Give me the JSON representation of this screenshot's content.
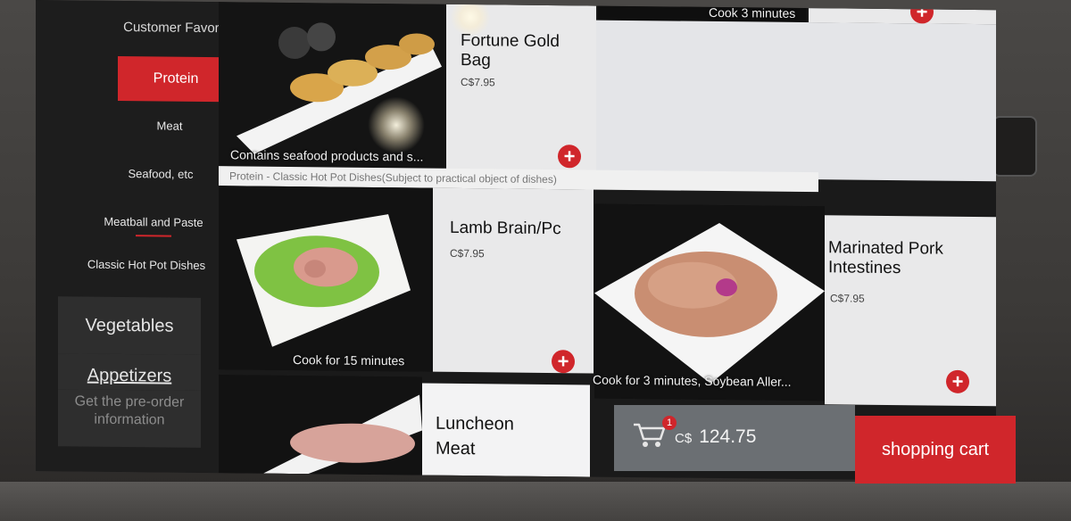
{
  "sidebar": {
    "categories": [
      {
        "label": "Customer Favorite's"
      },
      {
        "label": "Protein"
      },
      {
        "label": "Meat"
      },
      {
        "label": "Seafood, etc"
      },
      {
        "label": "Meatball and Paste"
      },
      {
        "label": "Classic Hot Pot Dishes"
      }
    ],
    "vegetables": "Vegetables",
    "appetizers": "Appetizers",
    "preorder": "Get the pre-order information"
  },
  "category_note": "Protein - Classic Hot Pot Dishes(Subject to practical object of dishes)",
  "top_right_caption": "Cook 3 minutes",
  "dishes": [
    {
      "name": "Fortune Gold Bag",
      "price": "C$7.95",
      "caption": "Contains seafood products and s..."
    },
    {
      "name": "Lamb Brain/Pc",
      "price": "C$7.95",
      "caption": "Cook for 15 minutes"
    },
    {
      "name": "Marinated Pork Intestines",
      "price": "C$7.95",
      "caption": "Cook for 3 minutes, Soybean Aller..."
    },
    {
      "name": "Luncheon Meat",
      "price": "",
      "caption": ""
    }
  ],
  "add_symbol": "+",
  "cart": {
    "badge": "1",
    "currency": "C$",
    "total": "124.75",
    "button_label": "shopping cart"
  },
  "colors": {
    "accent": "#d0262b",
    "card": "#e9e9ea",
    "cart_bar": "#6b6f73"
  }
}
